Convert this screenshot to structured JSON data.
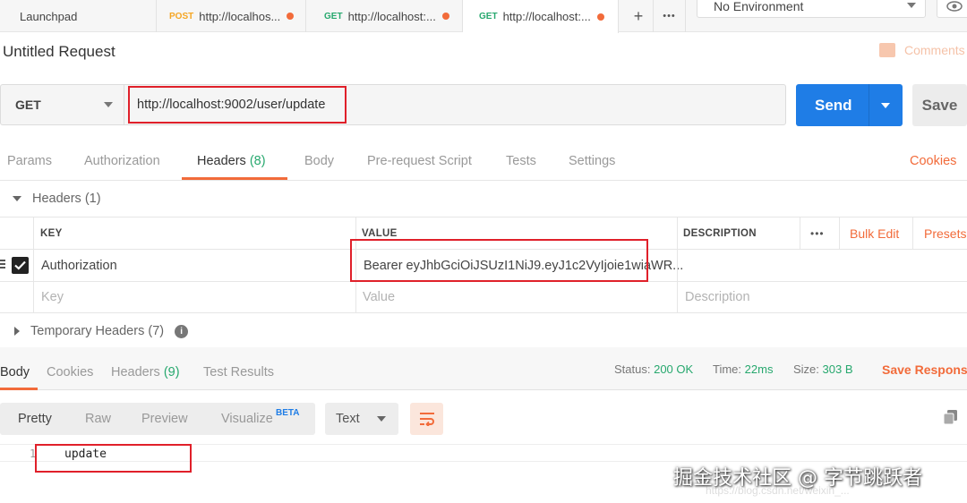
{
  "tabs": [
    {
      "label": "Launchpad",
      "method": ""
    },
    {
      "label": "http://localhos...",
      "method": "POST",
      "method_color": "#f5a623"
    },
    {
      "label": "http://localhost:...",
      "method": "GET",
      "method_color": "#27a86e"
    },
    {
      "label": "http://localhost:...",
      "method": "GET",
      "method_color": "#27a86e"
    }
  ],
  "tabbar": {
    "add_icon": "+",
    "more_icon": "•••"
  },
  "environment": {
    "selected": "No Environment"
  },
  "request": {
    "title": "Untitled Request",
    "comments_label": "Comments",
    "method": "GET",
    "url": "http://localhost:9002/user/update",
    "send_label": "Send",
    "save_label": "Save"
  },
  "request_tabs": [
    {
      "label": "Params",
      "count": ""
    },
    {
      "label": "Authorization",
      "count": ""
    },
    {
      "label": "Headers",
      "count": "(8)"
    },
    {
      "label": "Body",
      "count": ""
    },
    {
      "label": "Pre-request Script",
      "count": ""
    },
    {
      "label": "Tests",
      "count": ""
    },
    {
      "label": "Settings",
      "count": ""
    }
  ],
  "cookies_label": "Cookies",
  "headers_section": {
    "title": "Headers",
    "count": "(1)",
    "columns": {
      "key": "KEY",
      "value": "VALUE",
      "description": "DESCRIPTION"
    },
    "more_icon": "•••",
    "bulk_edit": "Bulk Edit",
    "presets": "Presets",
    "rows": [
      {
        "key": "Authorization",
        "value": "Bearer eyJhbGciOiJSUzI1NiJ9.eyJ1c2VyIjoie1wiaWR...",
        "description": ""
      }
    ],
    "placeholder": {
      "key": "Key",
      "value": "Value",
      "description": "Description"
    }
  },
  "temp_headers": {
    "title": "Temporary Headers",
    "count": "(7)"
  },
  "response": {
    "tabs": [
      {
        "label": "Body",
        "count": ""
      },
      {
        "label": "Cookies",
        "count": ""
      },
      {
        "label": "Headers",
        "count": "(9)"
      },
      {
        "label": "Test Results",
        "count": ""
      }
    ],
    "status_label": "Status:",
    "status_value": "200 OK",
    "time_label": "Time:",
    "time_value": "22ms",
    "size_label": "Size:",
    "size_value": "303 B",
    "save_response": "Save Response",
    "view_modes": [
      "Pretty",
      "Raw",
      "Preview",
      "Visualize"
    ],
    "beta_badge": "BETA",
    "format": "Text",
    "lines": [
      {
        "no": "1",
        "text": "update"
      }
    ]
  },
  "watermark": {
    "main": "掘金技术社区 @ 字节跳跃者",
    "sub": "https://blog.csdn.net/weixin_..."
  },
  "colors": {
    "accent": "#f26b3a",
    "send": "#1f7de6",
    "success": "#27a86e",
    "highlight_box": "#e0202a"
  }
}
